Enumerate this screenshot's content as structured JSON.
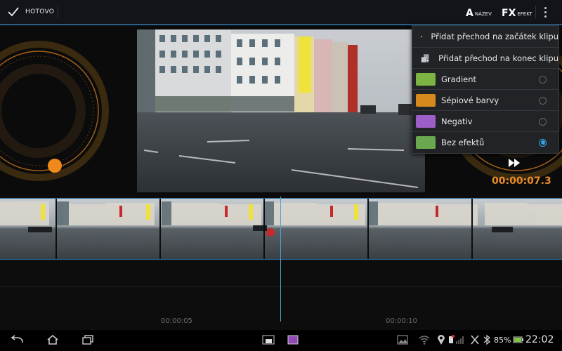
{
  "actionbar": {
    "done_label": "HOTOVO",
    "title_btn": {
      "big": "A",
      "small": "NÁZEV"
    },
    "effect_btn": {
      "big": "FX",
      "small": "EFEKT"
    }
  },
  "preview": {
    "timecode": "00:00:07.3"
  },
  "menu": {
    "items": [
      {
        "label": "Přidat přechod na začátek klipu",
        "icon": "transition-start-icon"
      },
      {
        "label": "Přidat přechod na konec klipu",
        "icon": "transition-end-icon"
      },
      {
        "label": "Gradient",
        "thumb_color": "#7cb342",
        "selected": false
      },
      {
        "label": "Sépiové barvy",
        "thumb_color": "#d68a1e",
        "selected": false
      },
      {
        "label": "Negativ",
        "thumb_color": "#9c5fc8",
        "selected": false
      },
      {
        "label": "Bez efektů",
        "thumb_color": "#6aa84f",
        "selected": true
      }
    ]
  },
  "timeline": {
    "marks": [
      "00:00:05",
      "00:00:10"
    ]
  },
  "statusbar": {
    "battery": "85%",
    "time": "22:02"
  },
  "colors": {
    "accent": "#33a8e8",
    "timecode": "#e98b2a"
  }
}
